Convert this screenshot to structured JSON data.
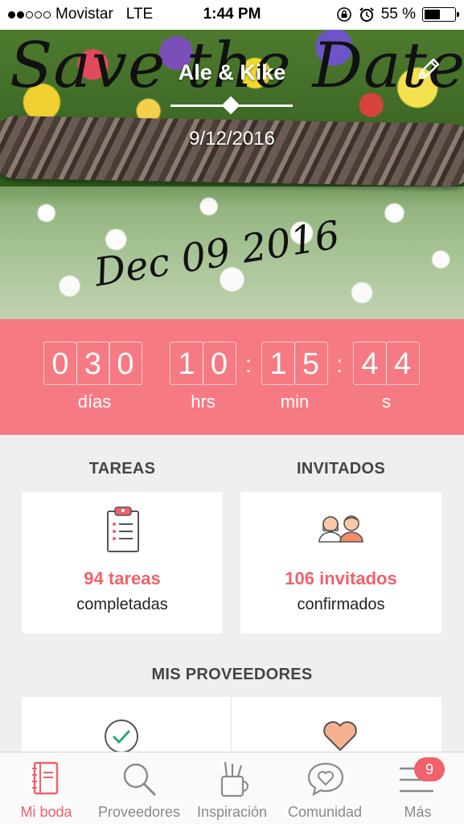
{
  "status_bar": {
    "carrier": "Movistar",
    "network": "LTE",
    "time": "1:44 PM",
    "battery": "55 %",
    "battery_level": 0.55,
    "signal_bars_filled": 2
  },
  "hero": {
    "script_title": "Save the Date",
    "couple": "Ale & Kike",
    "date": "9/12/2016",
    "script_date": "Dec 09 2016"
  },
  "countdown": {
    "days": [
      "0",
      "3",
      "0"
    ],
    "hours": [
      "1",
      "0"
    ],
    "minutes": [
      "1",
      "5"
    ],
    "seconds": [
      "4",
      "4"
    ],
    "labels": {
      "days": "días",
      "hours": "hrs",
      "minutes": "min",
      "seconds": "s"
    }
  },
  "sections": {
    "tasks_title": "TAREAS",
    "guests_title": "INVITADOS",
    "providers_title": "MIS PROVEEDORES"
  },
  "tasks_card": {
    "count": "94 tareas",
    "sub": "completadas"
  },
  "guests_card": {
    "count": "106 invitados",
    "sub": "confirmados"
  },
  "tabbar": {
    "items": [
      {
        "label": "Mi boda",
        "icon": "notebook-icon"
      },
      {
        "label": "Proveedores",
        "icon": "search-icon"
      },
      {
        "label": "Inspiración",
        "icon": "pencil-cup-icon"
      },
      {
        "label": "Comunidad",
        "icon": "chat-heart-icon"
      },
      {
        "label": "Más",
        "icon": "menu-icon"
      }
    ],
    "badge": "9"
  },
  "colors": {
    "accent": "#f57a83",
    "accent_text": "#f0616b",
    "check_green": "#2aa87a",
    "heart": "#f7b18f"
  }
}
